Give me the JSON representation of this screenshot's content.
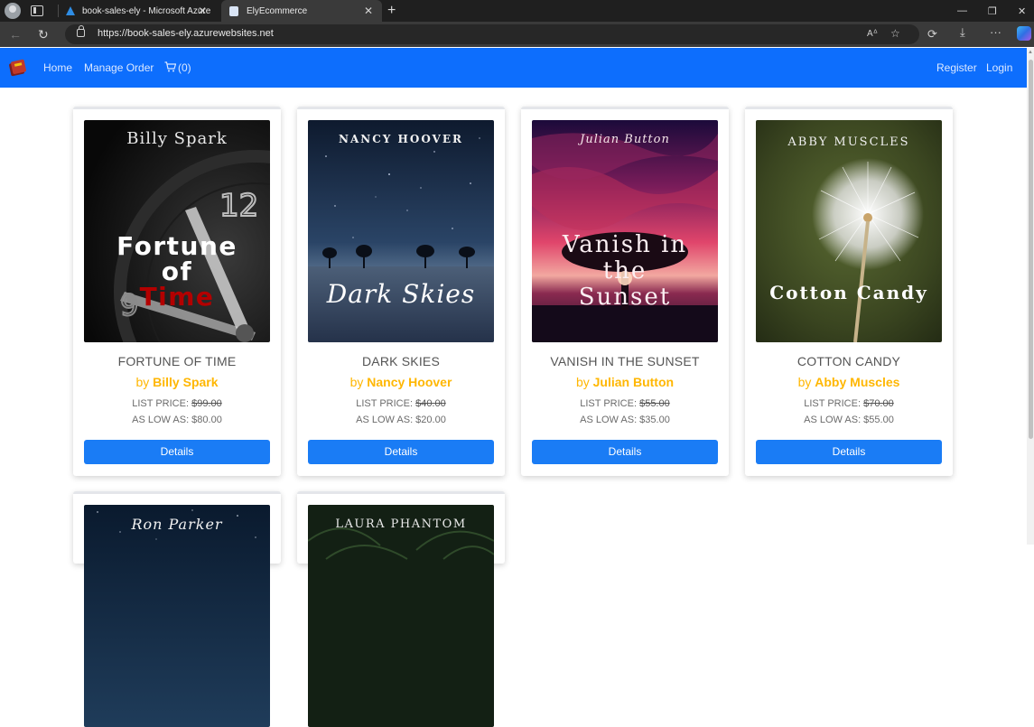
{
  "browser": {
    "tabs": [
      {
        "title": "book-sales-ely - Microsoft Azure",
        "active": false
      },
      {
        "title": "ElyEcommerce",
        "active": true
      }
    ],
    "url": "https://book-sales-ely.azurewebsites.net"
  },
  "navbar": {
    "links": {
      "home": "Home",
      "manage_order": "Manage Order",
      "cart_count": "(0)"
    },
    "auth": {
      "register": "Register",
      "login": "Login"
    },
    "colors": {
      "bar": "#0d6efd"
    }
  },
  "products": [
    {
      "cover": {
        "author": "Billy Spark",
        "title_lines": [
          "Fortune",
          "of",
          "Time"
        ]
      },
      "title": "FORTUNE OF TIME",
      "by": "by",
      "author": "Billy Spark",
      "list_label": "LIST PRICE:",
      "list_price": "$99.00",
      "low_text": "AS LOW AS: $80.00",
      "button": "Details"
    },
    {
      "cover": {
        "author": "NANCY HOOVER",
        "title_lines": [
          "Dark Skies"
        ]
      },
      "title": "DARK SKIES",
      "by": "by",
      "author": "Nancy Hoover",
      "list_label": "LIST PRICE:",
      "list_price": "$40.00",
      "low_text": "AS LOW AS: $20.00",
      "button": "Details"
    },
    {
      "cover": {
        "author": "Julian Button",
        "title_lines": [
          "Vanish in",
          "the",
          "Sunset"
        ]
      },
      "title": "VANISH IN THE SUNSET",
      "by": "by",
      "author": "Julian Button",
      "list_label": "LIST PRICE:",
      "list_price": "$55.00",
      "low_text": "AS LOW AS: $35.00",
      "button": "Details"
    },
    {
      "cover": {
        "author": "ABBY MUSCLES",
        "title_lines": [
          "Cotton Candy"
        ]
      },
      "title": "COTTON CANDY",
      "by": "by",
      "author": "Abby Muscles",
      "list_label": "LIST PRICE:",
      "list_price": "$70.00",
      "low_text": "AS LOW AS: $55.00",
      "button": "Details"
    },
    {
      "cover": {
        "author": "Ron Parker"
      }
    },
    {
      "cover": {
        "author": "LAURA PHANTOM"
      }
    }
  ],
  "colors": {
    "accent": "#1a7cf5",
    "author": "#ffb703"
  }
}
